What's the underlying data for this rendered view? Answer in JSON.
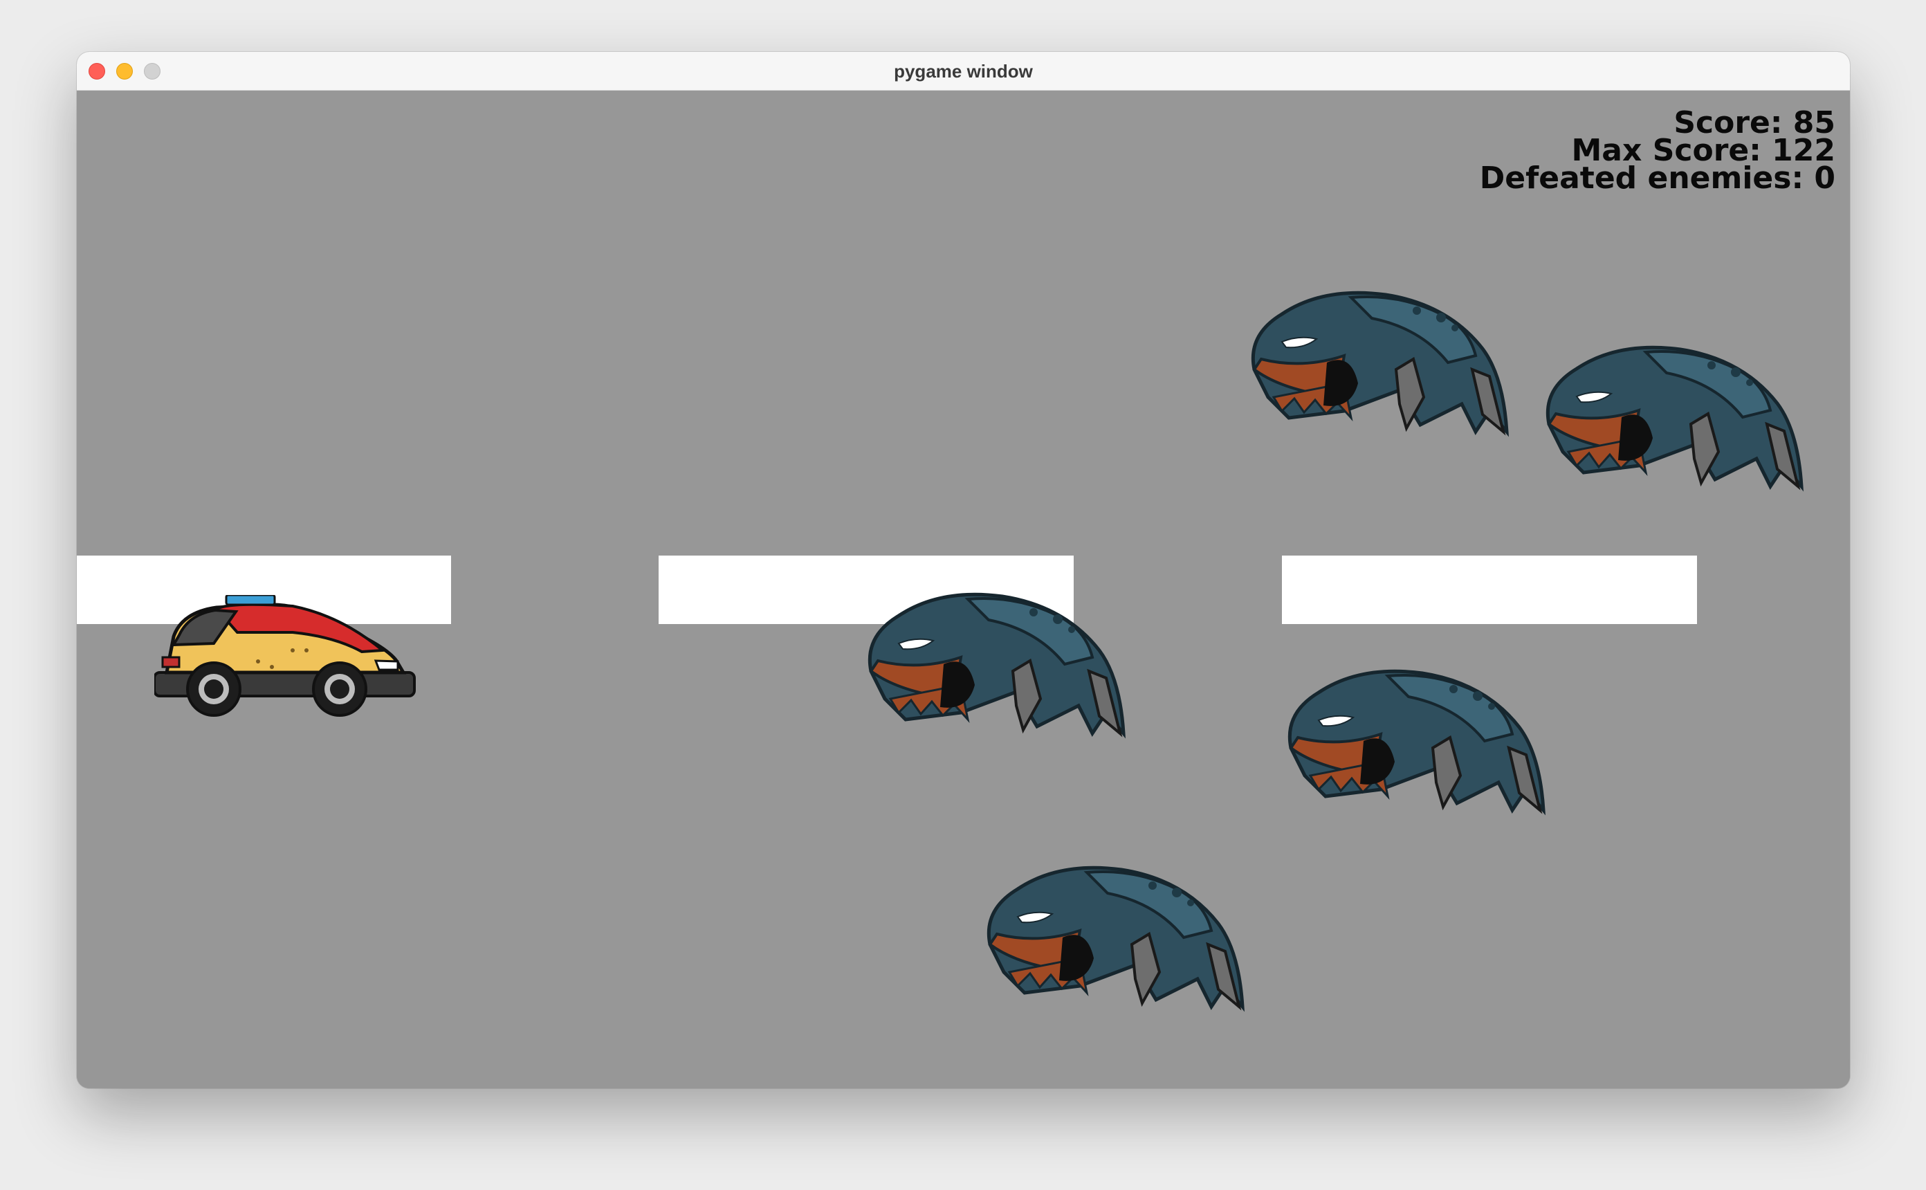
{
  "window": {
    "title": "pygame window",
    "background_color": "#979797"
  },
  "hud": {
    "score_label": "Score: 85",
    "max_score_label": "Max Score: 122",
    "defeated_label": "Defeated enemies: 0"
  },
  "sprites": {
    "player": "car",
    "enemy": "blue-beetle-monster",
    "enemy_count": 5,
    "platform_color": "#ffffff"
  }
}
